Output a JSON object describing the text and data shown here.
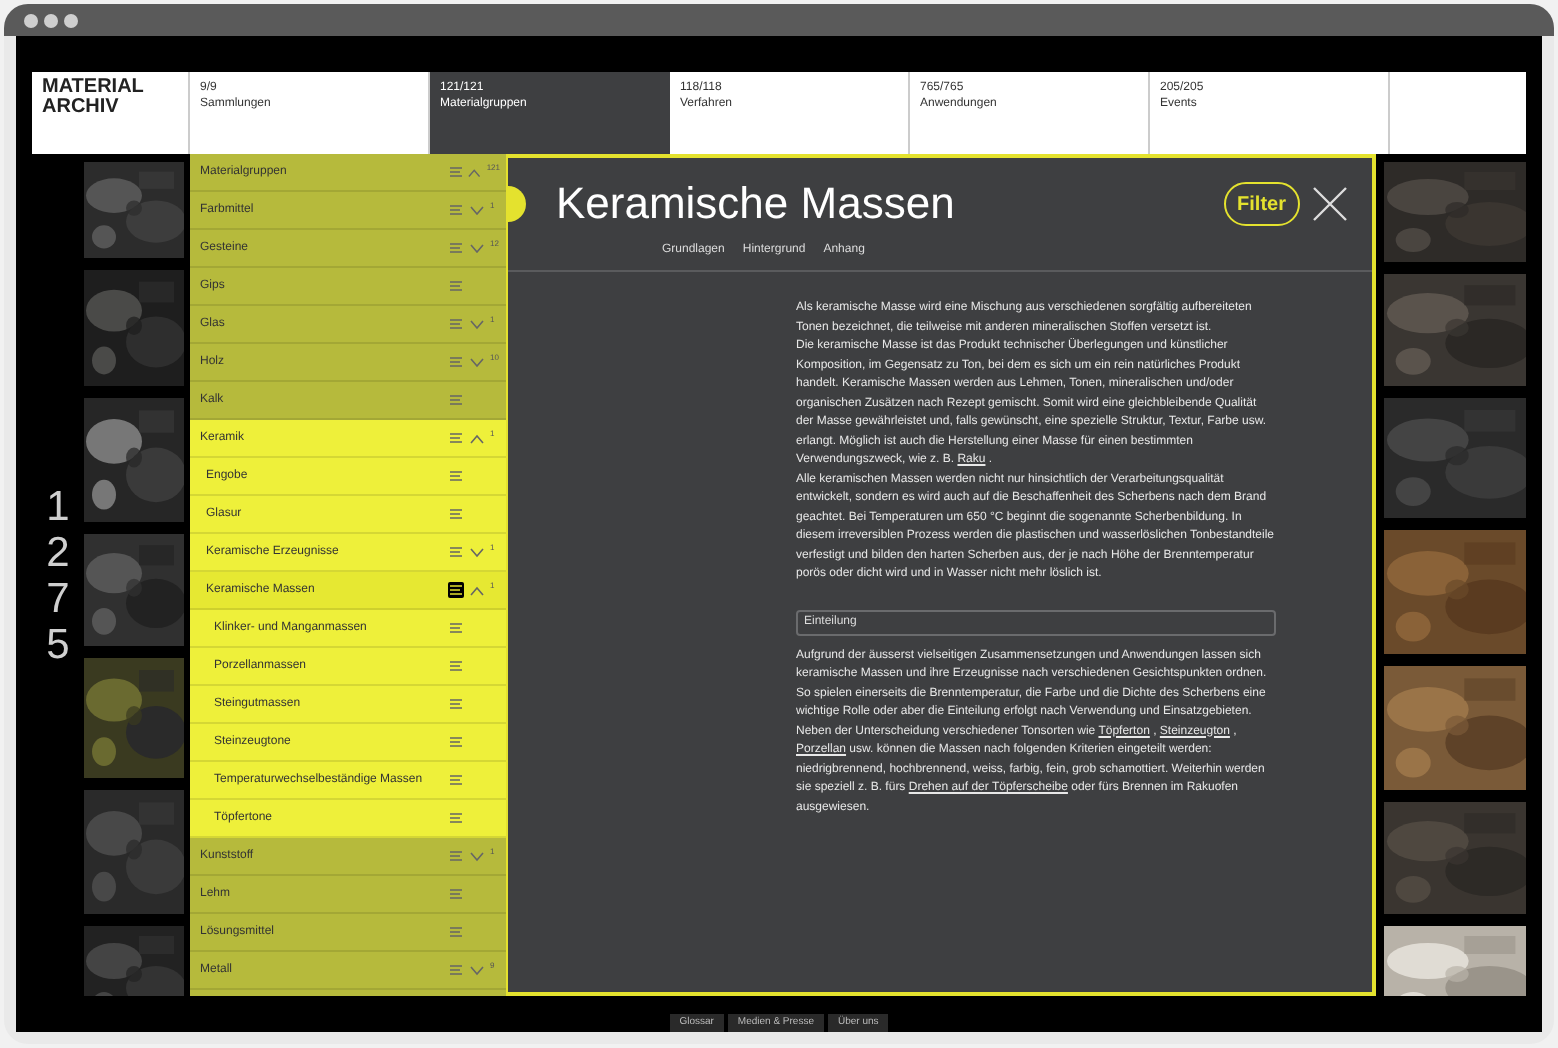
{
  "logo": "MATERIAL\nARCHIV",
  "nav": [
    {
      "count": "9/9",
      "label": "Sammlungen",
      "selected": false
    },
    {
      "count": "121/121",
      "label": "Materialgruppen",
      "selected": true
    },
    {
      "count": "118/118",
      "label": "Verfahren",
      "selected": false
    },
    {
      "count": "765/765",
      "label": "Anwendungen",
      "selected": false
    },
    {
      "count": "205/205",
      "label": "Events",
      "selected": false
    }
  ],
  "total_count": "1275",
  "sidebar": {
    "label": "Materialgruppen",
    "count": "121",
    "expanded": true,
    "items": [
      {
        "label": "Farbmittel",
        "count": "1",
        "expanded": false,
        "selected": false
      },
      {
        "label": "Gesteine",
        "count": "12",
        "expanded": false,
        "selected": false
      },
      {
        "label": "Gips",
        "selected": false
      },
      {
        "label": "Glas",
        "count": "1",
        "expanded": false,
        "selected": false
      },
      {
        "label": "Holz",
        "count": "10",
        "expanded": false,
        "selected": false
      },
      {
        "label": "Kalk",
        "selected": false
      },
      {
        "label": "Keramik",
        "count": "1",
        "expanded": true,
        "selected": false,
        "children": [
          {
            "label": "Engobe",
            "selected": false
          },
          {
            "label": "Glasur",
            "selected": false
          },
          {
            "label": "Keramische Erzeugnisse",
            "count": "1",
            "expanded": false,
            "selected": false
          },
          {
            "label": "Keramische Massen",
            "count": "1",
            "expanded": true,
            "selected": true,
            "children": [
              {
                "label": "Klinker- und Manganmassen",
                "selected": false
              },
              {
                "label": "Porzellanmassen",
                "selected": false
              },
              {
                "label": "Steingutmassen",
                "selected": false
              },
              {
                "label": "Steinzeugtone",
                "selected": false
              },
              {
                "label": "Temperaturwechselbeständige Massen",
                "selected": false
              },
              {
                "label": "Töpfertone",
                "selected": false
              }
            ]
          }
        ]
      },
      {
        "label": "Kunststoff",
        "count": "1",
        "expanded": false,
        "selected": false
      },
      {
        "label": "Lehm",
        "selected": false
      },
      {
        "label": "Lösungsmittel",
        "selected": false
      },
      {
        "label": "Metall",
        "count": "9",
        "expanded": false,
        "selected": false
      }
    ]
  },
  "detail": {
    "title": "Keramische Massen",
    "filter_button": "Filter",
    "tabs": [
      {
        "label": "Grundlagen"
      },
      {
        "label": "Hintergrund"
      },
      {
        "label": "Anhang"
      }
    ],
    "blocks": [
      {
        "kind": "paragraph",
        "segments": [
          {
            "kind": "text",
            "text": "Als keramische Masse wird eine Mischung aus verschiedenen sorgfältig aufbereiteten Tonen bezeichnet, die teilweise mit anderen mineralischen Stoffen versetzt ist."
          }
        ]
      },
      {
        "kind": "paragraph",
        "segments": [
          {
            "kind": "text",
            "text": "Die keramische Masse ist das Produkt technischer Überlegungen und künstlicher Komposition, im Gegensatz zu Ton, bei dem es sich um ein rein natürliches Produkt handelt. Keramische Massen werden aus Lehmen, Tonen, mineralischen und/oder organischen Zusätzen nach Rezept gemischt. Somit wird eine gleichbleibende Qualität der Masse gewährleistet und, falls gewünscht, eine spezielle Struktur, Textur, Farbe usw. erlangt. Möglich ist auch die Herstellung einer Masse für einen bestimmten Verwendungszweck, wie z. B. "
          },
          {
            "kind": "link",
            "text": "Raku"
          },
          {
            "kind": "text",
            "text": " ."
          }
        ]
      },
      {
        "kind": "paragraph",
        "segments": [
          {
            "kind": "text",
            "text": "Alle keramischen Massen werden nicht nur hinsichtlich der Verarbeitungsqualität entwickelt, sondern es wird auch auf die Beschaffenheit des Scherbens nach dem Brand geachtet. Bei Temperaturen um 650 °C beginnt die sogenannte Scherbenbildung. In diesem irreversiblen Prozess werden die plastischen und wasserlöslichen Tonbestandteile verfestigt und bilden den harten Scherben aus, der je nach Höhe der Brenntemperatur porös oder dicht wird und in Wasser nicht mehr löslich ist."
          }
        ]
      },
      {
        "kind": "heading",
        "text": "Einteilung"
      },
      {
        "kind": "paragraph",
        "segments": [
          {
            "kind": "text",
            "text": "Aufgrund der äusserst vielseitigen Zusammensetzungen und Anwendungen lassen sich keramische Massen und ihre Erzeugnisse nach verschiedenen Gesichtspunkten ordnen. So spielen einerseits die Brenntemperatur, die Farbe und die Dichte des Scherbens eine wichtige Rolle oder aber die Einteilung erfolgt nach Verwendung und Einsatzgebieten. Neben der Unterscheidung verschiedener Tonsorten wie "
          },
          {
            "kind": "link",
            "text": "Töpferton"
          },
          {
            "kind": "text",
            "text": " , "
          },
          {
            "kind": "link",
            "text": "Steinzeugton"
          },
          {
            "kind": "text",
            "text": " , "
          },
          {
            "kind": "link",
            "text": "Porzellan"
          },
          {
            "kind": "text",
            "text": " usw. können die Massen nach folgenden Kriterien eingeteilt werden: niedrigbrennend, hochbrennend, weiss, farbig, fein, grob schamottiert. Weiterhin werden sie speziell z. B. fürs "
          },
          {
            "kind": "link",
            "text": "Drehen auf der Töpferscheibe"
          },
          {
            "kind": "text",
            "text": " oder fürs Brennen im Rakuofen ausgewiesen."
          }
        ]
      }
    ]
  },
  "footer_links": [
    {
      "label": "Glossar"
    },
    {
      "label": "Medien & Presse"
    },
    {
      "label": "Über uns"
    }
  ]
}
